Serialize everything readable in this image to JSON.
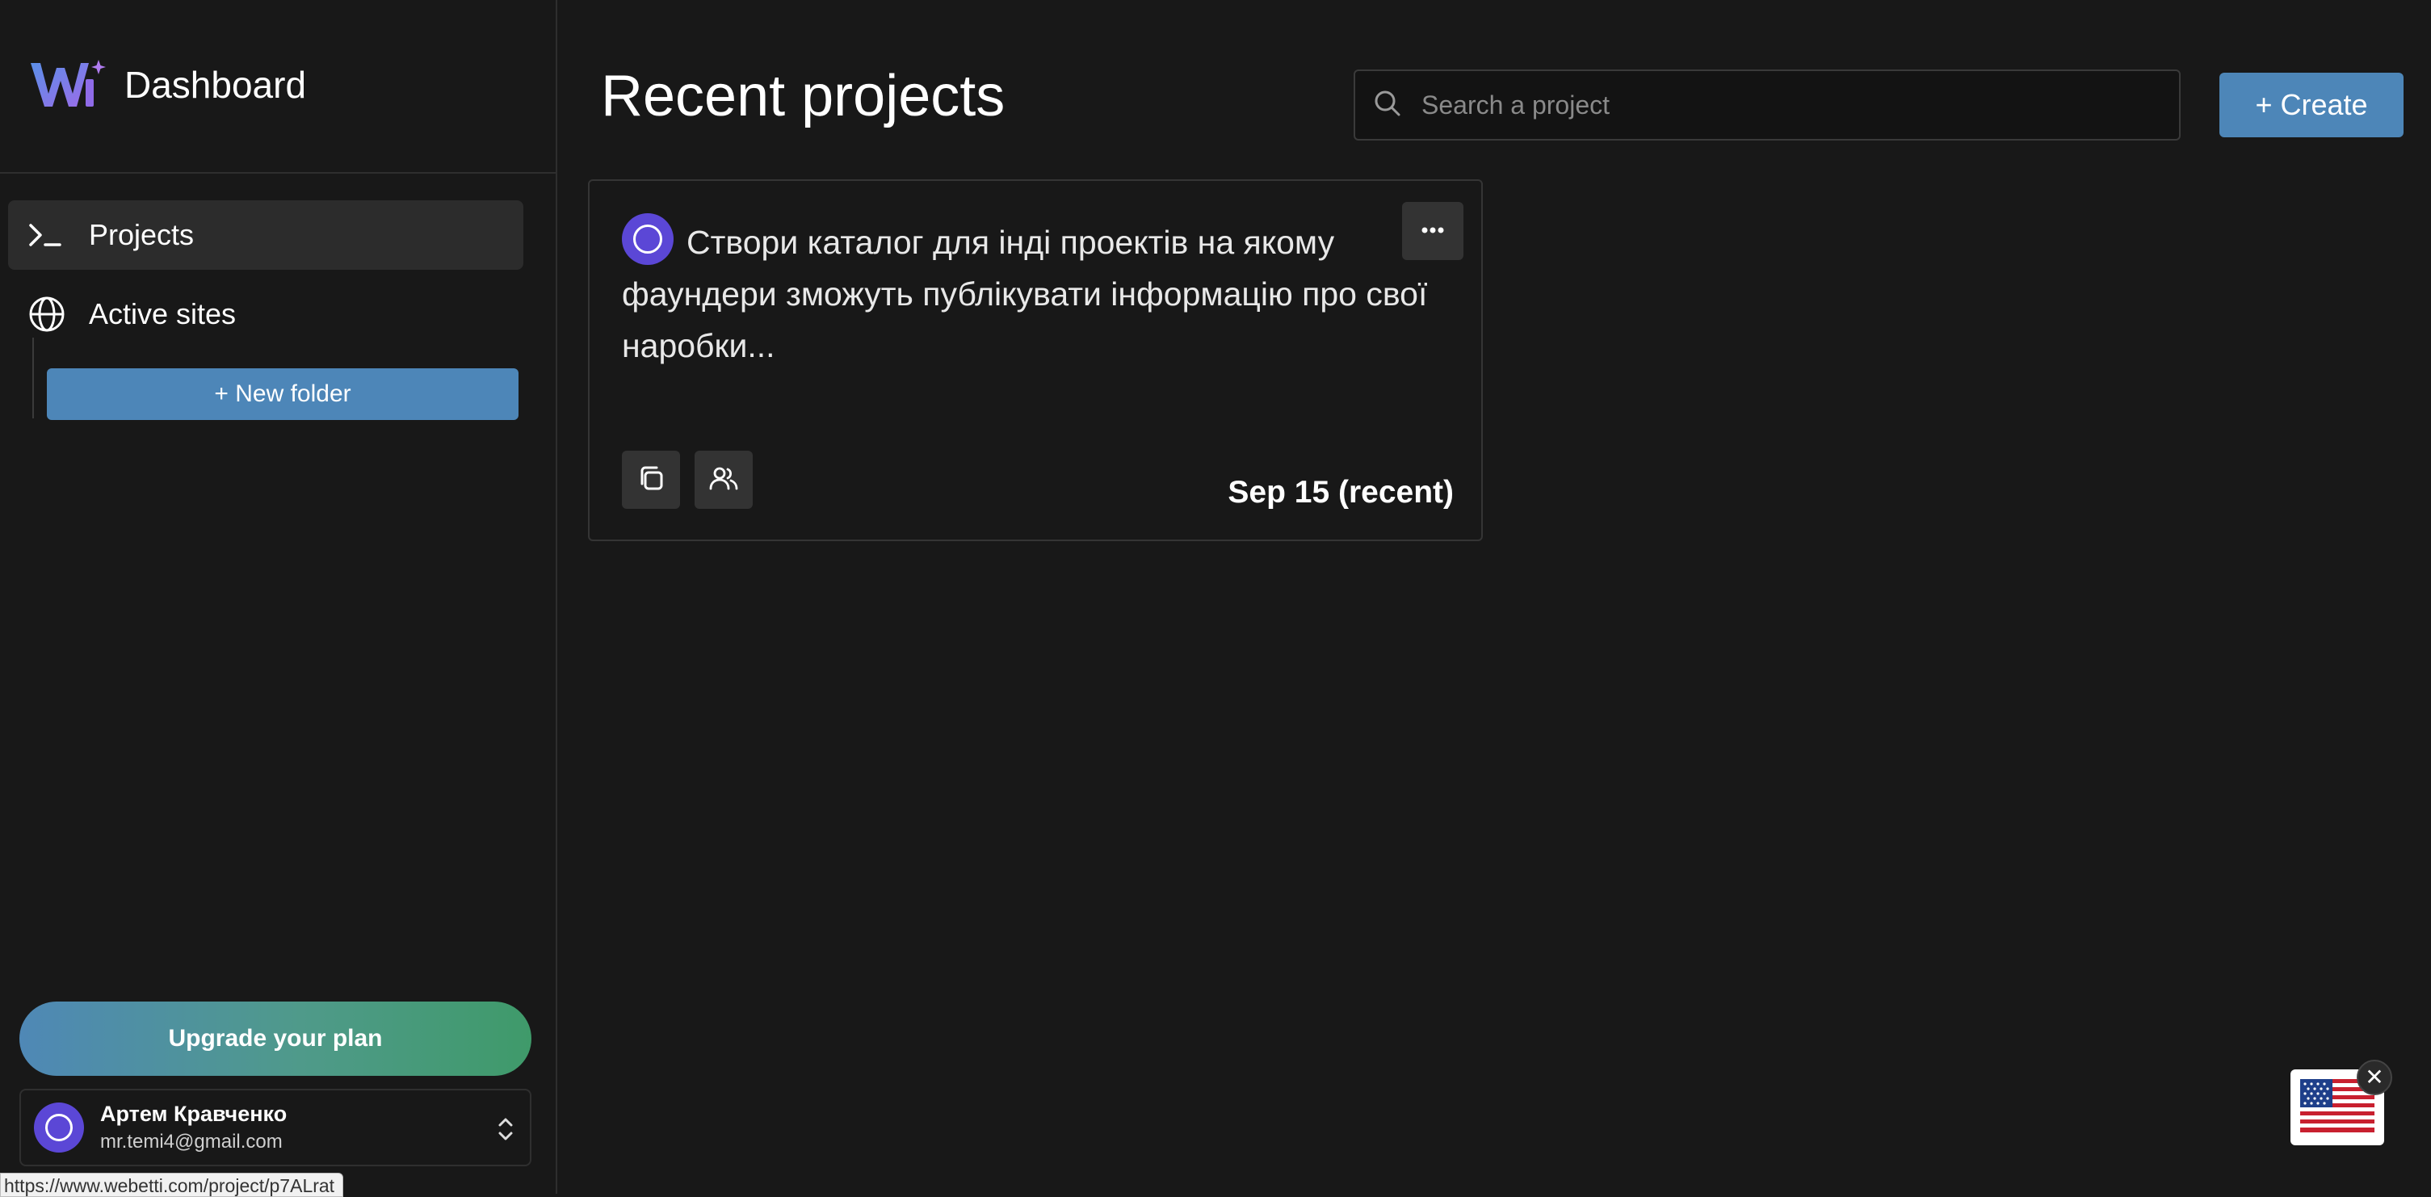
{
  "sidebar": {
    "brand_title": "Dashboard",
    "nav": [
      {
        "label": "Projects",
        "icon": "terminal-icon",
        "active": true
      },
      {
        "label": "Active sites",
        "icon": "globe-icon",
        "active": false
      }
    ],
    "new_folder_label": "+ New folder",
    "upgrade_label": "Upgrade your plan",
    "user": {
      "name": "Артем Кравченко",
      "email": "mr.temi4@gmail.com"
    }
  },
  "status_bar": {
    "url": "https://www.webetti.com/project/p7ALrat"
  },
  "main": {
    "title": "Recent projects",
    "search": {
      "placeholder": "Search a project",
      "value": ""
    },
    "create_label": "+ Create",
    "projects": [
      {
        "description": "Створи каталог для інді проектів на якому фаундери зможуть публікувати інформацію про свої наробки...",
        "date": "Sep 15 (recent)",
        "actions": [
          "copy-icon",
          "users-icon"
        ]
      }
    ]
  },
  "language_widget": {
    "flag": "🇺🇸",
    "close_label": "✕"
  },
  "colors": {
    "background": "#181818",
    "accent": "#4d86b8",
    "avatar": "#5b47d6",
    "logo_gradient": [
      "#5b8fe8",
      "#9b6ce8"
    ]
  }
}
